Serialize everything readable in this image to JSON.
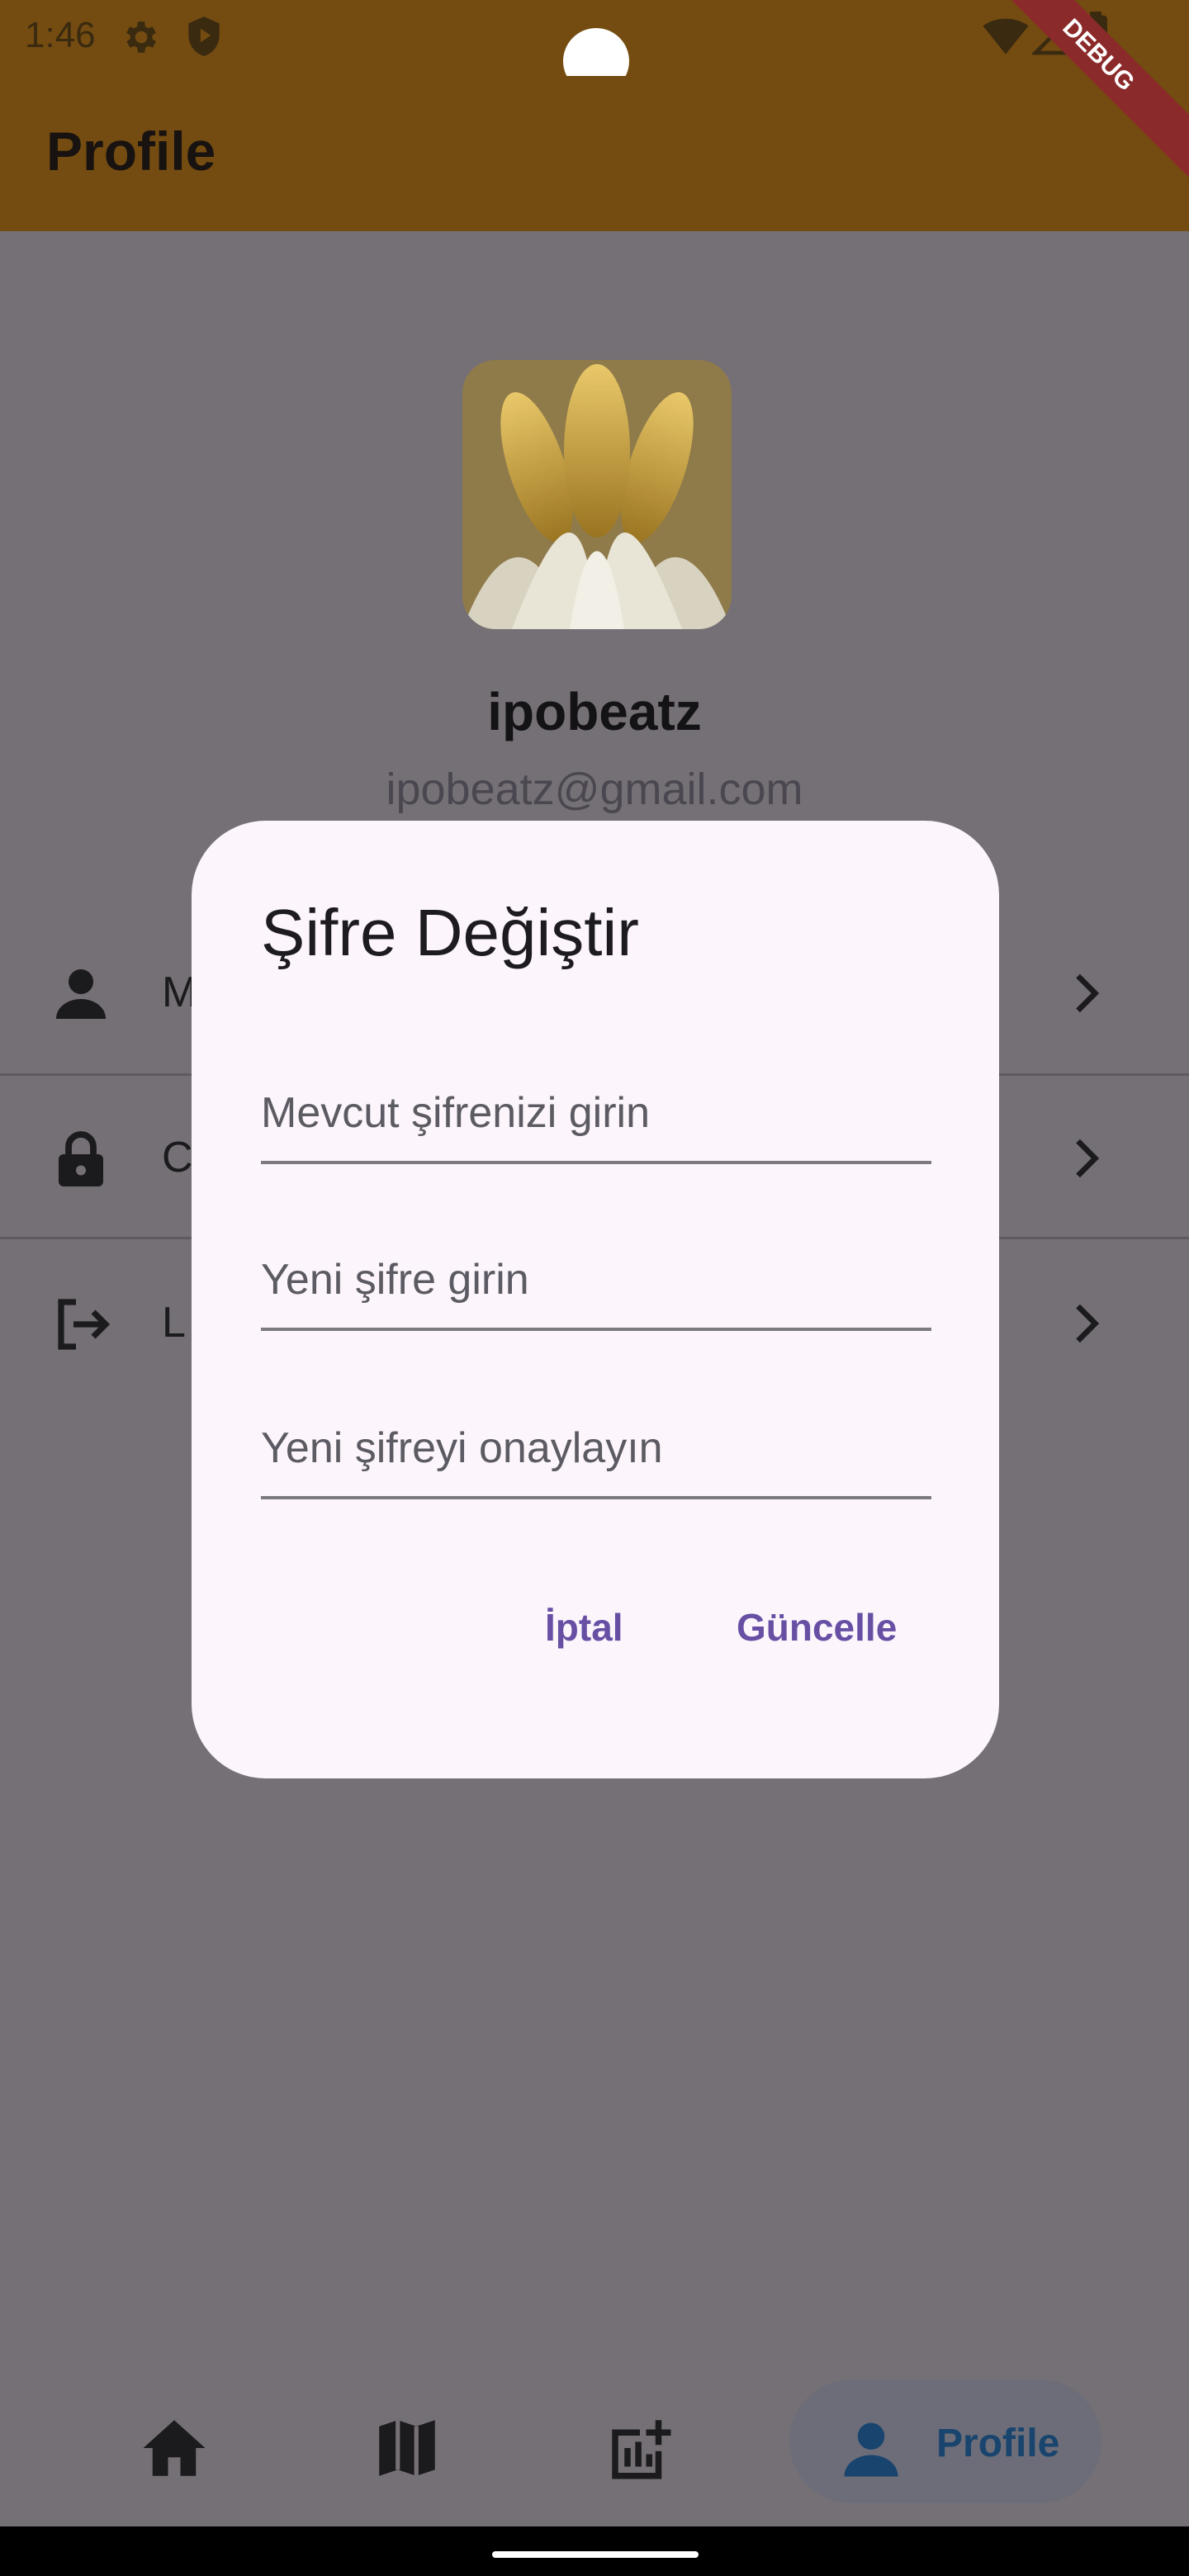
{
  "status_bar": {
    "time": "1:46"
  },
  "app_bar": {
    "title": "Profile"
  },
  "debug_banner": "DEBUG",
  "profile": {
    "username": "ipobeatz",
    "email": "ipobeatz@gmail.com"
  },
  "menu": {
    "items": [
      {
        "label": "M",
        "icon": "person-icon"
      },
      {
        "label": "C",
        "icon": "lock-icon"
      },
      {
        "label": "L",
        "icon": "logout-icon"
      }
    ]
  },
  "dialog": {
    "title": "Şifre Değiştir",
    "fields": [
      {
        "placeholder": "Mevcut şifrenizi girin"
      },
      {
        "placeholder": "Yeni şifre girin"
      },
      {
        "placeholder": "Yeni şifreyi onaylayın"
      }
    ],
    "cancel_label": "İptal",
    "confirm_label": "Güncelle"
  },
  "bottom_nav": {
    "items": [
      {
        "icon": "home-icon"
      },
      {
        "icon": "map-icon"
      },
      {
        "icon": "add-chart-icon"
      },
      {
        "icon": "person-icon",
        "label": "Profile",
        "selected": true
      }
    ]
  },
  "colors": {
    "app_bar": "#744c11",
    "scrim": "#757075",
    "dialog_bg": "#fcf5fc",
    "accent": "#6750a4"
  }
}
